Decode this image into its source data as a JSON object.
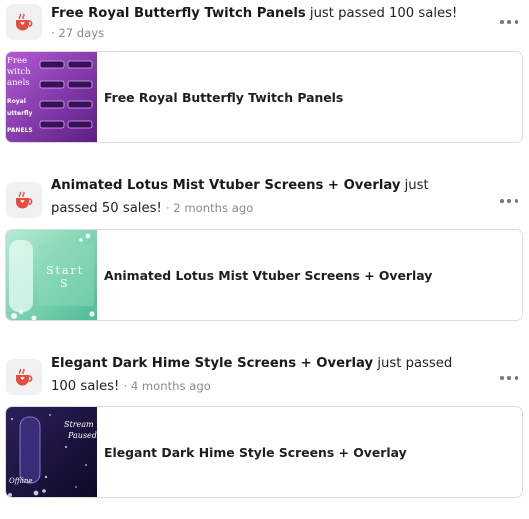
{
  "posts": [
    {
      "title_bold": "Free Royal Butterfly Twitch Panels",
      "title_rest": "just passed 100 sales!",
      "meta": "· 27 days",
      "card_title": "Free Royal Butterfly Twitch Panels",
      "thumb_text": [
        "Free",
        "witch",
        "anels",
        "Royal",
        "utterfly",
        "PANELS"
      ]
    },
    {
      "title_bold": "Animated Lotus Mist Vtuber Screens + Overlay",
      "title_rest": "just",
      "title_line2": "passed 50 sales!",
      "meta": "· 2 months ago",
      "card_title": "Animated Lotus Mist Vtuber Screens + Overlay",
      "thumb_text": [
        "Start",
        "S"
      ]
    },
    {
      "title_bold": "Elegant Dark Hime Style Screens + Overlay",
      "title_rest": "just passed",
      "title_line2": "100 sales!",
      "meta": "· 4 months ago",
      "card_title": "Elegant Dark Hime Style Screens + Overlay",
      "thumb_text": [
        "Stream",
        "Paused",
        "Offline"
      ]
    }
  ],
  "icons": {
    "avatar": "coffee-cup-icon",
    "more": "more-horizontal-icon"
  },
  "colors": {
    "accent": "#e94b3c",
    "meta_text": "#8b8b8b",
    "border": "#dcdcdc"
  }
}
